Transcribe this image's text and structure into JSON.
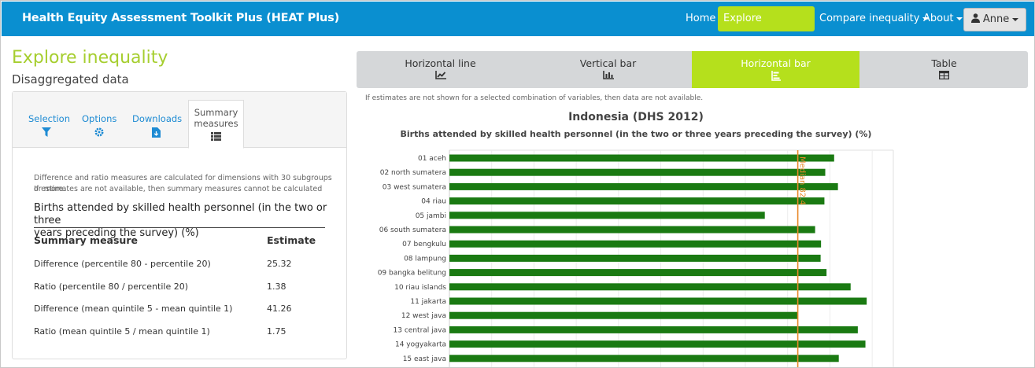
{
  "navbar": {
    "brand": "Health Equity Assessment Toolkit Plus (HEAT Plus)",
    "home": "Home",
    "explore": "Explore inequality",
    "compare": "Compare inequality",
    "about": "About",
    "user": "Anne"
  },
  "page": {
    "title": "Explore inequality",
    "subtitle": "Disaggregated data"
  },
  "left_tabs": {
    "selection": "Selection",
    "options": "Options",
    "downloads": "Downloads",
    "summary_line1": "Summary",
    "summary_line2": "measures"
  },
  "summary": {
    "note_line1": "Difference and ratio measures are calculated for dimensions with 30 subgroups or more.",
    "note_line2": "If estimates are not available, then summary measures cannot be calculated",
    "indicator_line1": "Births attended by skilled health personnel (in the two or three",
    "indicator_line2": "years preceding the survey) (%)",
    "col_measure": "Summary measure",
    "col_estimate": "Estimate",
    "rows": [
      {
        "measure": "Difference (percentile 80 - percentile 20)",
        "estimate": "25.32"
      },
      {
        "measure": "Ratio (percentile 80 / percentile 20)",
        "estimate": "1.38"
      },
      {
        "measure": "Difference (mean quintile 5 - mean quintile 1)",
        "estimate": "41.26"
      },
      {
        "measure": "Ratio (mean quintile 5 / mean quintile 1)",
        "estimate": "1.75"
      }
    ]
  },
  "viz_tabs": {
    "horizontal_line": "Horizontal line",
    "vertical_bar": "Vertical bar",
    "horizontal_bar": "Horizontal bar",
    "table": "Table"
  },
  "viz_note": "If estimates are not shown for a selected combination of variables, then data are not available.",
  "colors": {
    "accent": "#b5e01c",
    "navbar": "#0a8fd0",
    "bar": "#1a7a12",
    "median_line": "#e8892a",
    "link": "#1e8bd3"
  },
  "chart_data": {
    "type": "bar",
    "orientation": "horizontal",
    "title": "Indonesia (DHS 2012)",
    "subtitle": "Births attended by skilled health personnel (in the two or three years preceding the survey) (%)",
    "categories": [
      "01 aceh",
      "02 north sumatera",
      "03 west sumatera",
      "04 riau",
      "05 jambi",
      "06 south sumatera",
      "07 bengkulu",
      "08 lampung",
      "09 bangka belitung",
      "10 riau islands",
      "11 jakarta",
      "12 west java",
      "13 central java",
      "14 yogyakarta",
      "15 east java"
    ],
    "values": [
      91.0,
      88.9,
      91.9,
      88.7,
      74.6,
      86.5,
      87.9,
      87.8,
      89.2,
      94.9,
      98.7,
      82.4,
      96.6,
      98.4,
      92.1
    ],
    "xlim": [
      0,
      105
    ],
    "grid": true,
    "reference_line": {
      "label": "Median 82.4",
      "value": 82.4
    }
  }
}
